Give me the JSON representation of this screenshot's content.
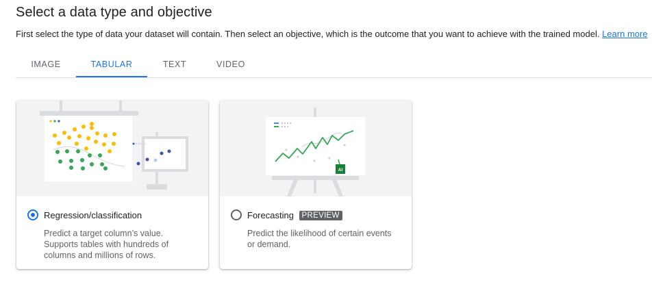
{
  "page": {
    "title": "Select a data type and objective",
    "subtitle": "First select the type of data your dataset will contain. Then select an objective, which is the outcome that you want to achieve with the trained model.",
    "learn_more": "Learn more"
  },
  "tabs": [
    {
      "label": "IMAGE",
      "active": false
    },
    {
      "label": "TABULAR",
      "active": true
    },
    {
      "label": "TEXT",
      "active": false
    },
    {
      "label": "VIDEO",
      "active": false
    }
  ],
  "objectives": [
    {
      "title": "Regression/classification",
      "selected": true,
      "badge": "",
      "description": "Predict a target column’s value. Supports tables with hundreds of columns and millions of rows."
    },
    {
      "title": "Forecasting",
      "selected": false,
      "badge": "PREVIEW",
      "description": "Predict the likelihood of certain events or demand."
    }
  ],
  "illustration": {
    "ai_chip_label": "AI"
  },
  "colors": {
    "accent": "#1a73e8",
    "yellow": "#fbbc04",
    "green": "#34a853",
    "indigo": "#3f51b5",
    "badge_bg": "#5f6368"
  }
}
